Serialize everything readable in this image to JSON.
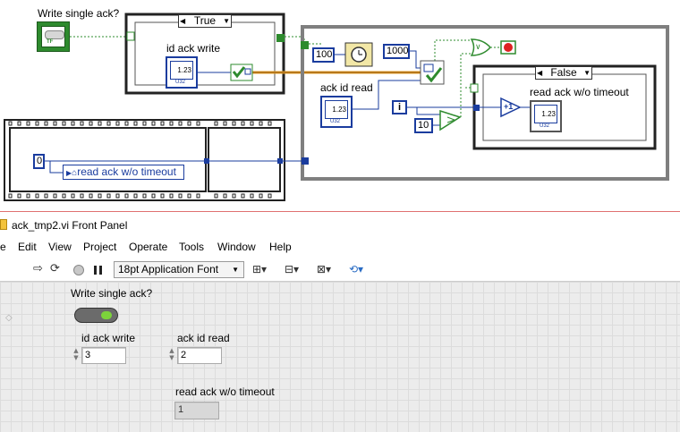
{
  "diagram": {
    "write_single_ack_label": "Write single ack?",
    "tf_terminal_text": "TF",
    "case_true_selector": "True",
    "id_ack_write_label": "id ack write",
    "u32_text": "U32",
    "numeric_text": "1.23",
    "wait_constant": "100",
    "timeout_constant": "1000",
    "ack_id_read_label": "ack id read",
    "iteration_text": "i",
    "compare_constant": "10",
    "case_false_selector": "False",
    "read_ack_label": "read ack w/o timeout",
    "increment_text": "+1",
    "zero_constant": "0",
    "local_var_text": "read ack w/o timeout",
    "or_text": "∨"
  },
  "window": {
    "title": "ack_tmp2.vi Front Panel",
    "menu": [
      "e",
      "Edit",
      "View",
      "Project",
      "Operate",
      "Tools",
      "Window",
      "Help"
    ],
    "font_select": "18pt Application Font"
  },
  "front_panel": {
    "write_single_ack_label": "Write single ack?",
    "id_ack_write_label": "id ack write",
    "id_ack_write_value": "3",
    "ack_id_read_label": "ack id read",
    "ack_id_read_value": "2",
    "read_ack_label": "read ack w/o timeout",
    "read_ack_value": "1"
  },
  "colors": {
    "bool_wire": "#2e8b2e",
    "int_wire": "#1a3c9e",
    "error_wire": "#e7a12a",
    "panel_bg": "#ececec"
  }
}
